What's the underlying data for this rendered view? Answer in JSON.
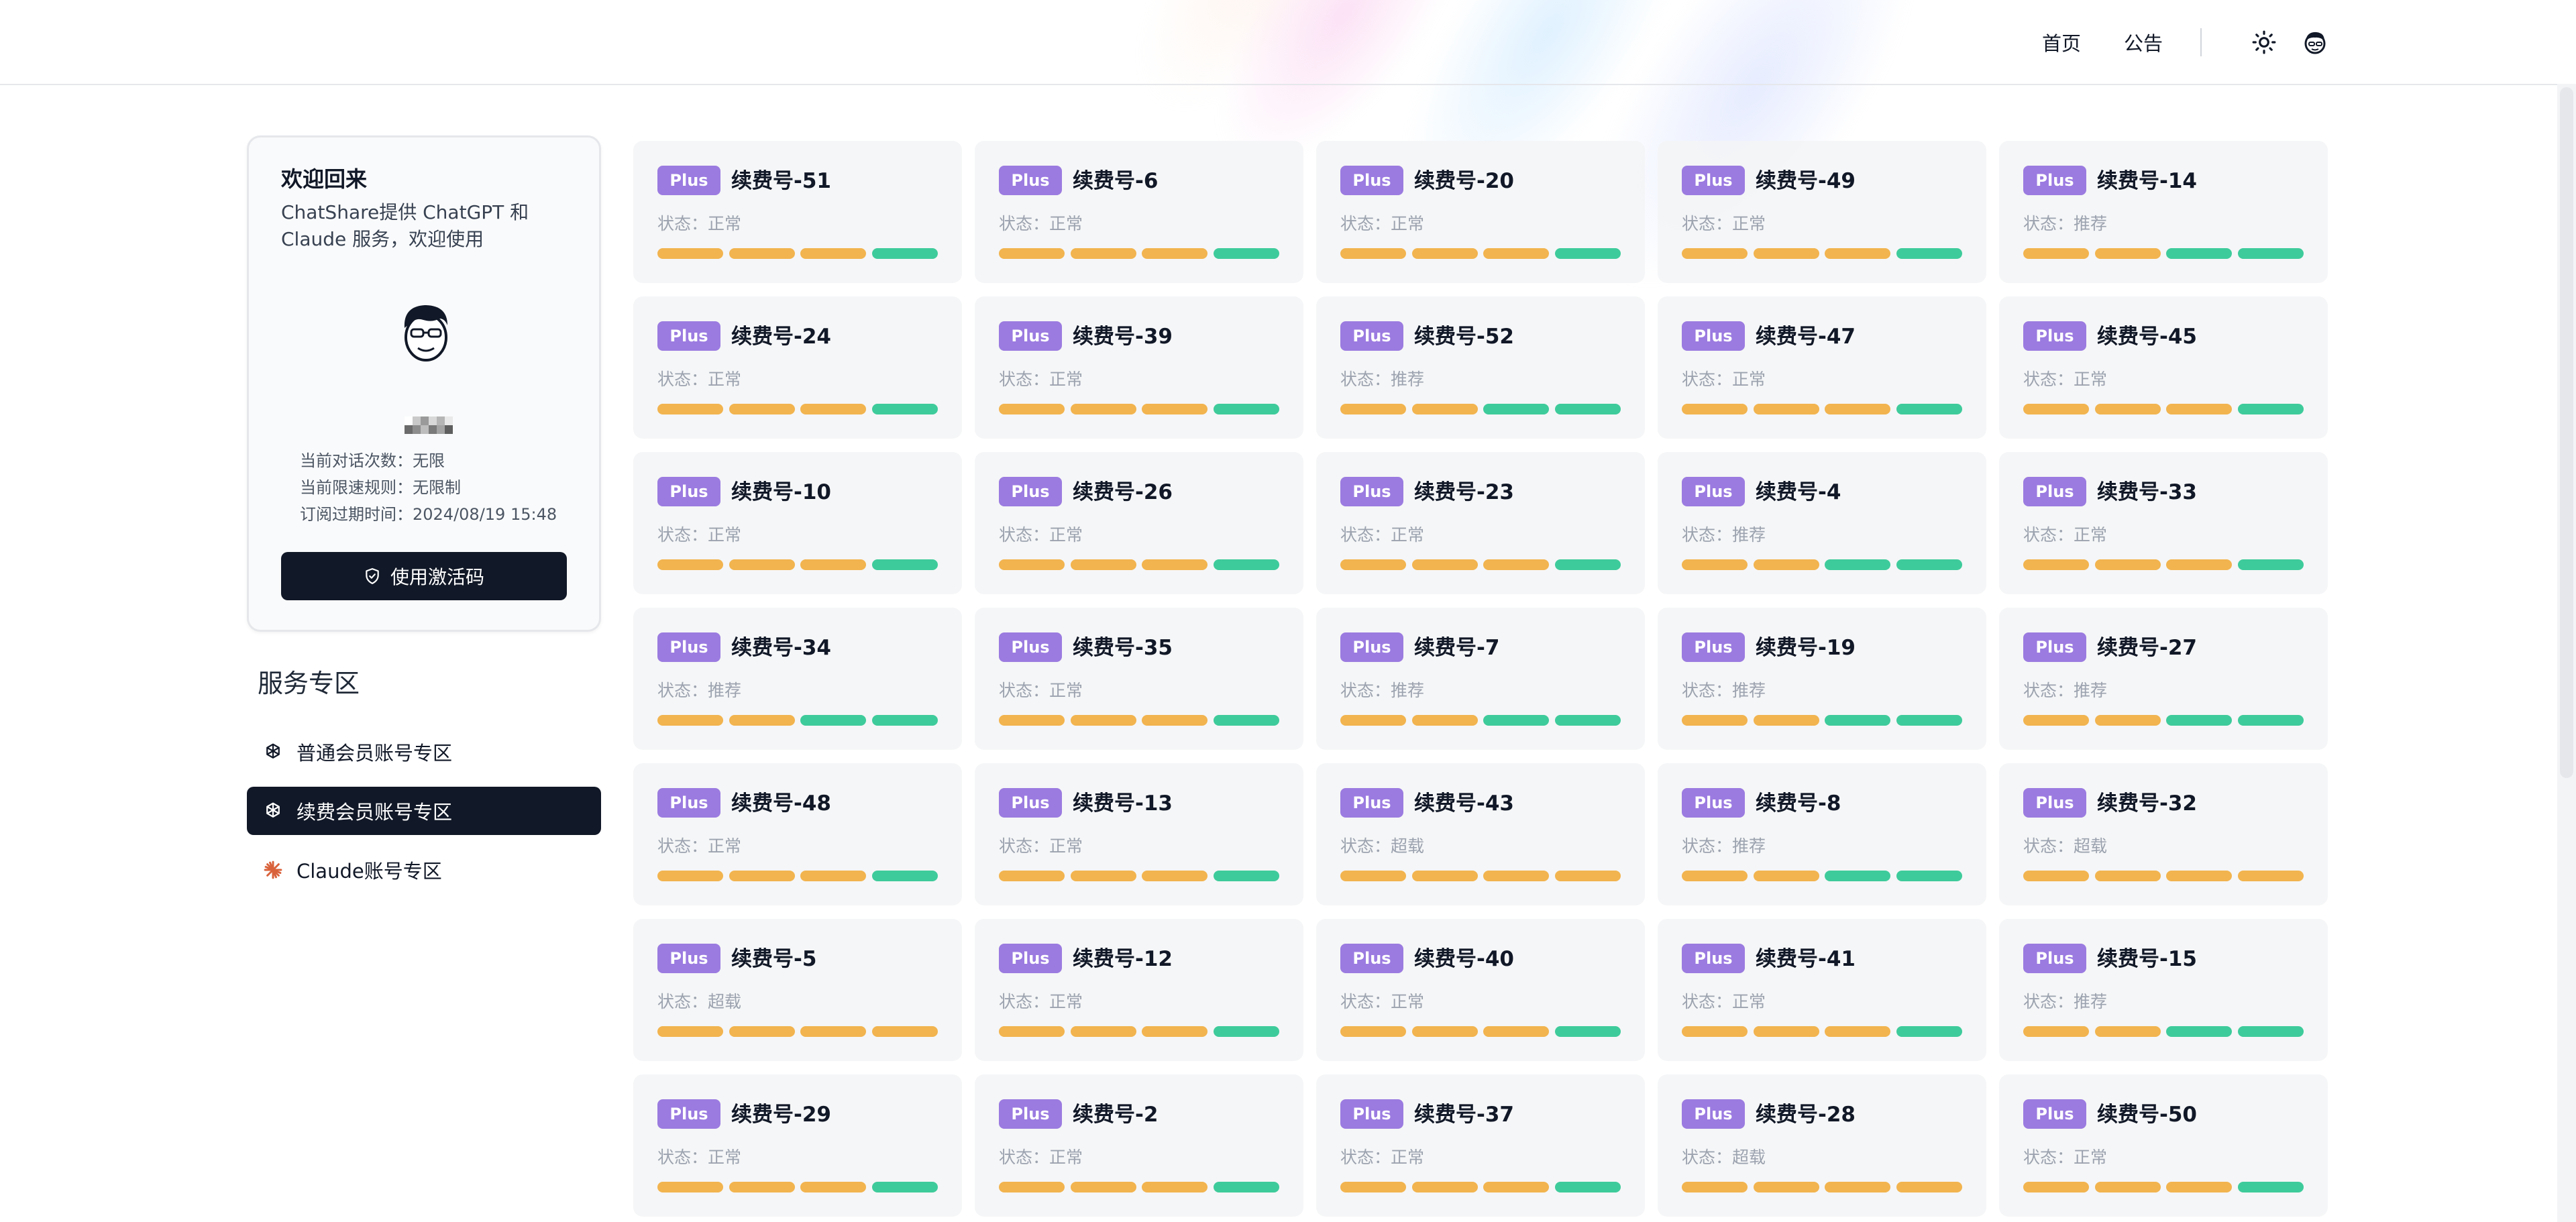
{
  "nav": {
    "home": "首页",
    "notice": "公告"
  },
  "welcome": {
    "title": "欢迎回来",
    "description": "ChatShare提供 ChatGPT 和 Claude 服务，欢迎使用",
    "info": [
      "当前对话次数：无限",
      "当前限速规则：无限制",
      "订阅过期时间：2024/08/19 15:48"
    ],
    "activate_button": "使用激活码"
  },
  "service": {
    "title": "服务专区",
    "items": [
      {
        "label": "普通会员账号专区",
        "icon": "openai-icon",
        "active": false
      },
      {
        "label": "续费会员账号专区",
        "icon": "openai-icon",
        "active": true
      },
      {
        "label": "Claude账号专区",
        "icon": "claude-icon",
        "active": false
      }
    ]
  },
  "colors": {
    "plus_badge": "#9b7be0",
    "bar_yellow": "#f2b44f",
    "bar_green": "#3ecb9b",
    "active_bg": "#111827"
  },
  "accounts": [
    {
      "badge": "Plus",
      "name": "续费号-51",
      "status": "状态：正常",
      "bars": [
        "y",
        "y",
        "y",
        "g"
      ]
    },
    {
      "badge": "Plus",
      "name": "续费号-6",
      "status": "状态：正常",
      "bars": [
        "y",
        "y",
        "y",
        "g"
      ]
    },
    {
      "badge": "Plus",
      "name": "续费号-20",
      "status": "状态：正常",
      "bars": [
        "y",
        "y",
        "y",
        "g"
      ]
    },
    {
      "badge": "Plus",
      "name": "续费号-49",
      "status": "状态：正常",
      "bars": [
        "y",
        "y",
        "y",
        "g"
      ]
    },
    {
      "badge": "Plus",
      "name": "续费号-14",
      "status": "状态：推荐",
      "bars": [
        "y",
        "y",
        "g",
        "g"
      ]
    },
    {
      "badge": "Plus",
      "name": "续费号-24",
      "status": "状态：正常",
      "bars": [
        "y",
        "y",
        "y",
        "g"
      ]
    },
    {
      "badge": "Plus",
      "name": "续费号-39",
      "status": "状态：正常",
      "bars": [
        "y",
        "y",
        "y",
        "g"
      ]
    },
    {
      "badge": "Plus",
      "name": "续费号-52",
      "status": "状态：推荐",
      "bars": [
        "y",
        "y",
        "g",
        "g"
      ]
    },
    {
      "badge": "Plus",
      "name": "续费号-47",
      "status": "状态：正常",
      "bars": [
        "y",
        "y",
        "y",
        "g"
      ]
    },
    {
      "badge": "Plus",
      "name": "续费号-45",
      "status": "状态：正常",
      "bars": [
        "y",
        "y",
        "y",
        "g"
      ]
    },
    {
      "badge": "Plus",
      "name": "续费号-10",
      "status": "状态：正常",
      "bars": [
        "y",
        "y",
        "y",
        "g"
      ]
    },
    {
      "badge": "Plus",
      "name": "续费号-26",
      "status": "状态：正常",
      "bars": [
        "y",
        "y",
        "y",
        "g"
      ]
    },
    {
      "badge": "Plus",
      "name": "续费号-23",
      "status": "状态：正常",
      "bars": [
        "y",
        "y",
        "y",
        "g"
      ]
    },
    {
      "badge": "Plus",
      "name": "续费号-4",
      "status": "状态：推荐",
      "bars": [
        "y",
        "y",
        "g",
        "g"
      ]
    },
    {
      "badge": "Plus",
      "name": "续费号-33",
      "status": "状态：正常",
      "bars": [
        "y",
        "y",
        "y",
        "g"
      ]
    },
    {
      "badge": "Plus",
      "name": "续费号-34",
      "status": "状态：推荐",
      "bars": [
        "y",
        "y",
        "g",
        "g"
      ]
    },
    {
      "badge": "Plus",
      "name": "续费号-35",
      "status": "状态：正常",
      "bars": [
        "y",
        "y",
        "y",
        "g"
      ]
    },
    {
      "badge": "Plus",
      "name": "续费号-7",
      "status": "状态：推荐",
      "bars": [
        "y",
        "y",
        "g",
        "g"
      ]
    },
    {
      "badge": "Plus",
      "name": "续费号-19",
      "status": "状态：推荐",
      "bars": [
        "y",
        "y",
        "g",
        "g"
      ]
    },
    {
      "badge": "Plus",
      "name": "续费号-27",
      "status": "状态：推荐",
      "bars": [
        "y",
        "y",
        "g",
        "g"
      ]
    },
    {
      "badge": "Plus",
      "name": "续费号-48",
      "status": "状态：正常",
      "bars": [
        "y",
        "y",
        "y",
        "g"
      ]
    },
    {
      "badge": "Plus",
      "name": "续费号-13",
      "status": "状态：正常",
      "bars": [
        "y",
        "y",
        "y",
        "g"
      ]
    },
    {
      "badge": "Plus",
      "name": "续费号-43",
      "status": "状态：超载",
      "bars": [
        "y",
        "y",
        "y",
        "y"
      ]
    },
    {
      "badge": "Plus",
      "name": "续费号-8",
      "status": "状态：推荐",
      "bars": [
        "y",
        "y",
        "g",
        "g"
      ]
    },
    {
      "badge": "Plus",
      "name": "续费号-32",
      "status": "状态：超载",
      "bars": [
        "y",
        "y",
        "y",
        "y"
      ]
    },
    {
      "badge": "Plus",
      "name": "续费号-5",
      "status": "状态：超载",
      "bars": [
        "y",
        "y",
        "y",
        "y"
      ]
    },
    {
      "badge": "Plus",
      "name": "续费号-12",
      "status": "状态：正常",
      "bars": [
        "y",
        "y",
        "y",
        "g"
      ]
    },
    {
      "badge": "Plus",
      "name": "续费号-40",
      "status": "状态：正常",
      "bars": [
        "y",
        "y",
        "y",
        "g"
      ]
    },
    {
      "badge": "Plus",
      "name": "续费号-41",
      "status": "状态：正常",
      "bars": [
        "y",
        "y",
        "y",
        "g"
      ]
    },
    {
      "badge": "Plus",
      "name": "续费号-15",
      "status": "状态：推荐",
      "bars": [
        "y",
        "y",
        "g",
        "g"
      ]
    },
    {
      "badge": "Plus",
      "name": "续费号-29",
      "status": "状态：正常",
      "bars": [
        "y",
        "y",
        "y",
        "g"
      ]
    },
    {
      "badge": "Plus",
      "name": "续费号-2",
      "status": "状态：正常",
      "bars": [
        "y",
        "y",
        "y",
        "g"
      ]
    },
    {
      "badge": "Plus",
      "name": "续费号-37",
      "status": "状态：正常",
      "bars": [
        "y",
        "y",
        "y",
        "g"
      ]
    },
    {
      "badge": "Plus",
      "name": "续费号-28",
      "status": "状态：超载",
      "bars": [
        "y",
        "y",
        "y",
        "y"
      ]
    },
    {
      "badge": "Plus",
      "name": "续费号-50",
      "status": "状态：正常",
      "bars": [
        "y",
        "y",
        "y",
        "g"
      ]
    }
  ]
}
